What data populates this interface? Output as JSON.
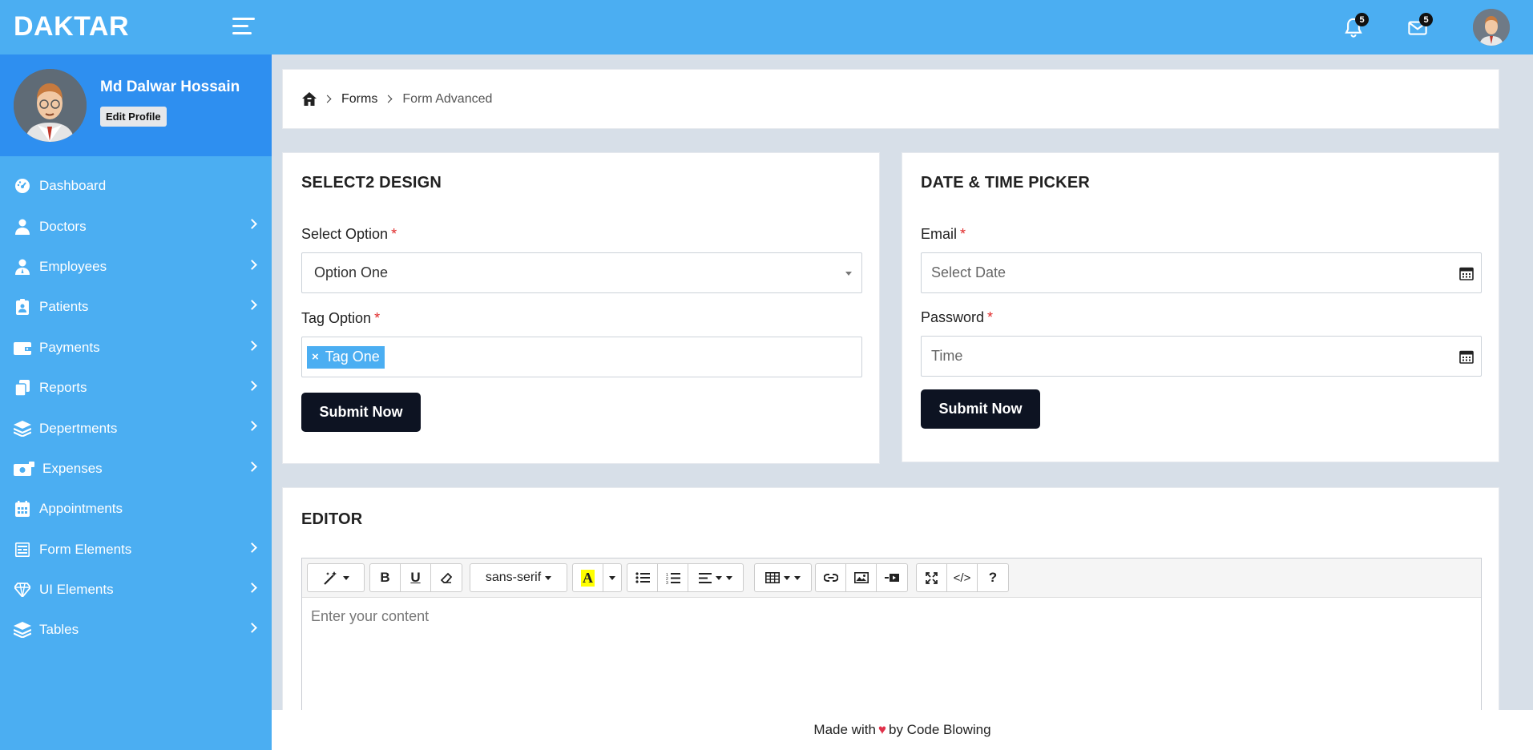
{
  "header": {
    "brand": "DAKTAR",
    "notification_count": "5",
    "message_count": "5"
  },
  "profile": {
    "name": "Md Dalwar Hossain",
    "edit_label": "Edit Profile"
  },
  "sidebar": {
    "items": [
      {
        "label": "Dashboard",
        "icon": "dashboard-icon"
      },
      {
        "label": "Doctors",
        "icon": "doctor-icon"
      },
      {
        "label": "Employees",
        "icon": "employee-icon"
      },
      {
        "label": "Patients",
        "icon": "patient-icon"
      },
      {
        "label": "Payments",
        "icon": "wallet-icon"
      },
      {
        "label": "Reports",
        "icon": "copy-icon"
      },
      {
        "label": "Depertments",
        "icon": "layers-icon"
      },
      {
        "label": "Expenses",
        "icon": "money-icon"
      },
      {
        "label": "Appointments",
        "icon": "calendar-icon"
      },
      {
        "label": "Form Elements",
        "icon": "form-icon"
      },
      {
        "label": "UI Elements",
        "icon": "gem-icon"
      },
      {
        "label": "Tables",
        "icon": "layers-icon"
      }
    ]
  },
  "breadcrumb": {
    "item1": "Forms",
    "item2": "Form Advanced"
  },
  "select2": {
    "title": "SELECT2 DESIGN",
    "select_label": "Select Option",
    "select_value": "Option One",
    "tag_label": "Tag Option",
    "tag_value": "Tag One",
    "tag_remove": "×",
    "submit": "Submit Now",
    "required_mark": "*"
  },
  "datetime": {
    "title": "DATE & TIME PICKER",
    "email_label": "Email",
    "email_placeholder": "Select Date",
    "password_label": "Password",
    "password_placeholder": "Time",
    "submit": "Submit Now",
    "required_mark": "*"
  },
  "editor": {
    "title": "EDITOR",
    "font_name": "sans-serif",
    "placeholder": "Enter your content",
    "help": "?",
    "code": "</>"
  },
  "footer": {
    "made_with": "Made with",
    "heart": "♥",
    "by": "by Code Blowing"
  }
}
